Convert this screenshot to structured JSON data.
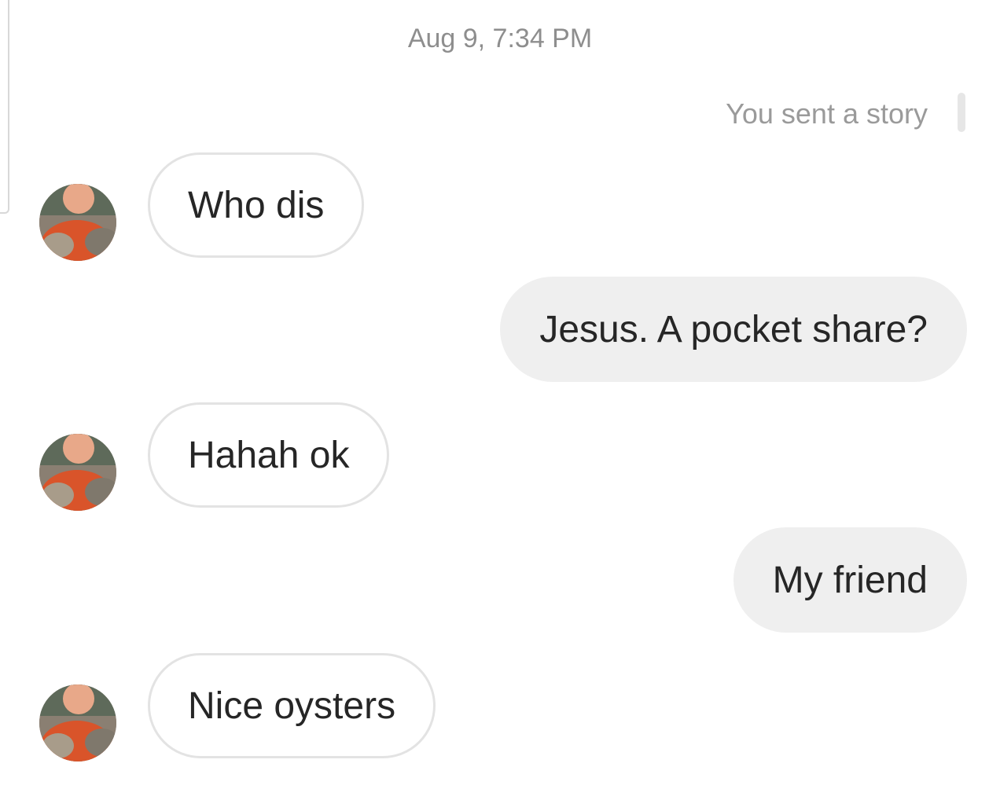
{
  "thread": {
    "timestamp": "Aug 9, 7:34 PM",
    "story_note": "You sent a story"
  },
  "messages": [
    {
      "direction": "incoming",
      "text": "Who dis"
    },
    {
      "direction": "outgoing",
      "text": "Jesus. A pocket share?"
    },
    {
      "direction": "incoming",
      "text": "Hahah ok"
    },
    {
      "direction": "outgoing",
      "text": "My friend"
    },
    {
      "direction": "incoming",
      "text": "Nice oysters"
    }
  ],
  "avatar": {
    "icon": "profile-photo-person-with-cats",
    "shirt_color": "#d9542a",
    "skin_color": "#e8a889",
    "background_color": "#8a7f72"
  }
}
